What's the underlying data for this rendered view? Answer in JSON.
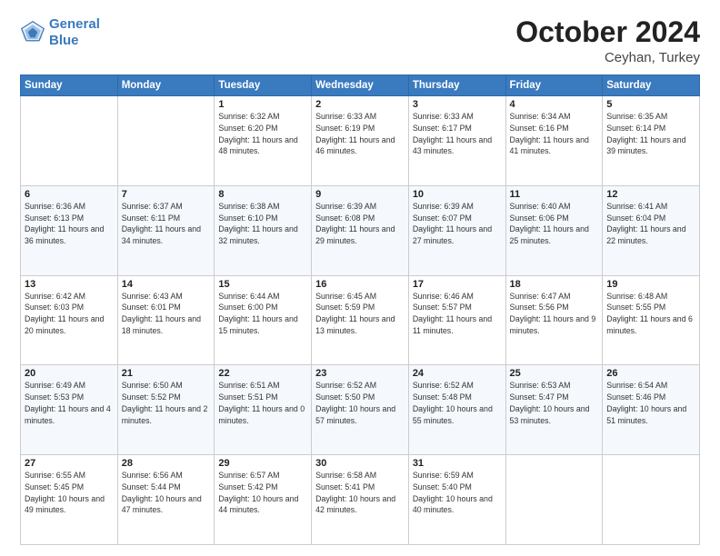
{
  "header": {
    "logo_line1": "General",
    "logo_line2": "Blue",
    "month": "October 2024",
    "location": "Ceyhan, Turkey"
  },
  "weekdays": [
    "Sunday",
    "Monday",
    "Tuesday",
    "Wednesday",
    "Thursday",
    "Friday",
    "Saturday"
  ],
  "weeks": [
    [
      {
        "day": "",
        "info": ""
      },
      {
        "day": "",
        "info": ""
      },
      {
        "day": "1",
        "info": "Sunrise: 6:32 AM\nSunset: 6:20 PM\nDaylight: 11 hours and 48 minutes."
      },
      {
        "day": "2",
        "info": "Sunrise: 6:33 AM\nSunset: 6:19 PM\nDaylight: 11 hours and 46 minutes."
      },
      {
        "day": "3",
        "info": "Sunrise: 6:33 AM\nSunset: 6:17 PM\nDaylight: 11 hours and 43 minutes."
      },
      {
        "day": "4",
        "info": "Sunrise: 6:34 AM\nSunset: 6:16 PM\nDaylight: 11 hours and 41 minutes."
      },
      {
        "day": "5",
        "info": "Sunrise: 6:35 AM\nSunset: 6:14 PM\nDaylight: 11 hours and 39 minutes."
      }
    ],
    [
      {
        "day": "6",
        "info": "Sunrise: 6:36 AM\nSunset: 6:13 PM\nDaylight: 11 hours and 36 minutes."
      },
      {
        "day": "7",
        "info": "Sunrise: 6:37 AM\nSunset: 6:11 PM\nDaylight: 11 hours and 34 minutes."
      },
      {
        "day": "8",
        "info": "Sunrise: 6:38 AM\nSunset: 6:10 PM\nDaylight: 11 hours and 32 minutes."
      },
      {
        "day": "9",
        "info": "Sunrise: 6:39 AM\nSunset: 6:08 PM\nDaylight: 11 hours and 29 minutes."
      },
      {
        "day": "10",
        "info": "Sunrise: 6:39 AM\nSunset: 6:07 PM\nDaylight: 11 hours and 27 minutes."
      },
      {
        "day": "11",
        "info": "Sunrise: 6:40 AM\nSunset: 6:06 PM\nDaylight: 11 hours and 25 minutes."
      },
      {
        "day": "12",
        "info": "Sunrise: 6:41 AM\nSunset: 6:04 PM\nDaylight: 11 hours and 22 minutes."
      }
    ],
    [
      {
        "day": "13",
        "info": "Sunrise: 6:42 AM\nSunset: 6:03 PM\nDaylight: 11 hours and 20 minutes."
      },
      {
        "day": "14",
        "info": "Sunrise: 6:43 AM\nSunset: 6:01 PM\nDaylight: 11 hours and 18 minutes."
      },
      {
        "day": "15",
        "info": "Sunrise: 6:44 AM\nSunset: 6:00 PM\nDaylight: 11 hours and 15 minutes."
      },
      {
        "day": "16",
        "info": "Sunrise: 6:45 AM\nSunset: 5:59 PM\nDaylight: 11 hours and 13 minutes."
      },
      {
        "day": "17",
        "info": "Sunrise: 6:46 AM\nSunset: 5:57 PM\nDaylight: 11 hours and 11 minutes."
      },
      {
        "day": "18",
        "info": "Sunrise: 6:47 AM\nSunset: 5:56 PM\nDaylight: 11 hours and 9 minutes."
      },
      {
        "day": "19",
        "info": "Sunrise: 6:48 AM\nSunset: 5:55 PM\nDaylight: 11 hours and 6 minutes."
      }
    ],
    [
      {
        "day": "20",
        "info": "Sunrise: 6:49 AM\nSunset: 5:53 PM\nDaylight: 11 hours and 4 minutes."
      },
      {
        "day": "21",
        "info": "Sunrise: 6:50 AM\nSunset: 5:52 PM\nDaylight: 11 hours and 2 minutes."
      },
      {
        "day": "22",
        "info": "Sunrise: 6:51 AM\nSunset: 5:51 PM\nDaylight: 11 hours and 0 minutes."
      },
      {
        "day": "23",
        "info": "Sunrise: 6:52 AM\nSunset: 5:50 PM\nDaylight: 10 hours and 57 minutes."
      },
      {
        "day": "24",
        "info": "Sunrise: 6:52 AM\nSunset: 5:48 PM\nDaylight: 10 hours and 55 minutes."
      },
      {
        "day": "25",
        "info": "Sunrise: 6:53 AM\nSunset: 5:47 PM\nDaylight: 10 hours and 53 minutes."
      },
      {
        "day": "26",
        "info": "Sunrise: 6:54 AM\nSunset: 5:46 PM\nDaylight: 10 hours and 51 minutes."
      }
    ],
    [
      {
        "day": "27",
        "info": "Sunrise: 6:55 AM\nSunset: 5:45 PM\nDaylight: 10 hours and 49 minutes."
      },
      {
        "day": "28",
        "info": "Sunrise: 6:56 AM\nSunset: 5:44 PM\nDaylight: 10 hours and 47 minutes."
      },
      {
        "day": "29",
        "info": "Sunrise: 6:57 AM\nSunset: 5:42 PM\nDaylight: 10 hours and 44 minutes."
      },
      {
        "day": "30",
        "info": "Sunrise: 6:58 AM\nSunset: 5:41 PM\nDaylight: 10 hours and 42 minutes."
      },
      {
        "day": "31",
        "info": "Sunrise: 6:59 AM\nSunset: 5:40 PM\nDaylight: 10 hours and 40 minutes."
      },
      {
        "day": "",
        "info": ""
      },
      {
        "day": "",
        "info": ""
      }
    ]
  ]
}
